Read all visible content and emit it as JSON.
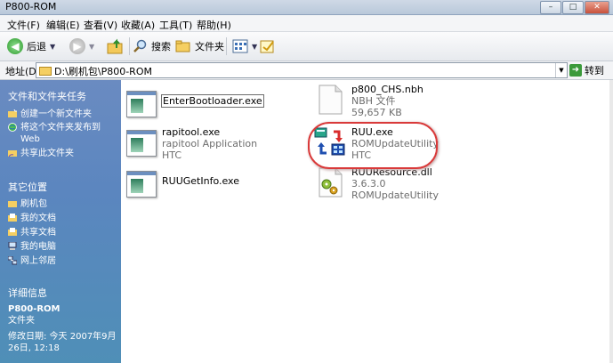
{
  "window": {
    "title": "P800-ROM"
  },
  "menu": [
    "文件(F)",
    "编辑(E)",
    "查看(V)",
    "收藏(A)",
    "工具(T)",
    "帮助(H)"
  ],
  "toolbar": {
    "back": "后退",
    "search": "搜索",
    "folders": "文件夹"
  },
  "address": {
    "label": "地址(D)",
    "path": "D:\\刷机包\\P800-ROM",
    "go": "转到"
  },
  "tasks": {
    "title": "文件和文件夹任务",
    "items": [
      "创建一个新文件夹",
      "将这个文件夹发布到 Web",
      "共享此文件夹"
    ]
  },
  "places": {
    "title": "其它位置",
    "items": [
      "刷机包",
      "我的文档",
      "共享文档",
      "我的电脑",
      "网上邻居"
    ]
  },
  "details": {
    "title": "详细信息",
    "name": "P800-ROM",
    "type": "文件夹",
    "modified_line1": "修改日期: 今天 2007年9月",
    "modified_line2": "26日, 12:18"
  },
  "files": [
    {
      "name": "EnterBootloader.exe",
      "line2": "",
      "line3": ""
    },
    {
      "name": "p800_CHS.nbh",
      "line2": "NBH 文件",
      "line3": "59,657 KB"
    },
    {
      "name": "rapitool.exe",
      "line2": "rapitool Application",
      "line3": "HTC"
    },
    {
      "name": "RUU.exe",
      "line2": "ROMUpdateUtility",
      "line3": "HTC"
    },
    {
      "name": "RUUGetInfo.exe",
      "line2": "",
      "line3": ""
    },
    {
      "name": "RUUResource.dll",
      "line2": "3.6.3.0",
      "line3": "ROMUpdateUtility"
    }
  ],
  "colors": {
    "pane_top": "#6a8bc1",
    "pane_bottom": "#4f8fb7",
    "highlight_ring": "#d93a3a"
  }
}
